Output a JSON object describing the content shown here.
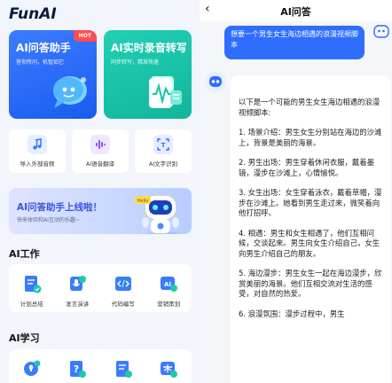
{
  "app": {
    "title": "FunAI"
  },
  "feature_cards": [
    {
      "title": "AI问答助手",
      "subtitle": "答你所问，机智如它",
      "badge": "HOT",
      "color": "#2a6bff"
    },
    {
      "title": "AI实时录音转写",
      "subtitle": "同步转写，精准快速",
      "color": "#17c3a6"
    }
  ],
  "tools": [
    {
      "label": "导入外部音频",
      "icon": "music-note-icon",
      "color": "#3a7bff"
    },
    {
      "label": "AI语音翻译",
      "icon": "soundwave-icon",
      "color": "#8a54f5"
    },
    {
      "label": "AI文字识别",
      "icon": "scan-text-icon",
      "color": "#2f6dff"
    }
  ],
  "banner": {
    "title": "AI问答助手上线啦！",
    "subtitle": "快来体验和AI互动的乐趣~",
    "robot_tag": "Hello"
  },
  "sections": [
    {
      "title": "AI工作",
      "items": [
        {
          "label": "计划总结",
          "icon": "document-check-icon"
        },
        {
          "label": "发言演讲",
          "icon": "microphone-icon"
        },
        {
          "label": "代码编写",
          "icon": "code-icon"
        },
        {
          "label": "营销策划",
          "icon": "ai-spark-icon"
        }
      ]
    },
    {
      "title": "AI学习",
      "items": [
        {
          "label": "",
          "icon": "lightbulb-icon"
        },
        {
          "label": "",
          "icon": "question-icon"
        },
        {
          "label": "",
          "icon": "edit-document-icon"
        },
        {
          "label": "",
          "icon": "translate-icon"
        }
      ]
    }
  ],
  "chat": {
    "back_icon": "chevron-left-icon",
    "title": "AI问答",
    "user_message": "想要一个男生女生海边相遇的浪漫视频脚本",
    "bot_intro": "以下是一个可能的男生女生海边相遇的浪漫视频脚本:",
    "bot_paragraphs": [
      "1. 场景介绍：男生女生分别站在海边的沙滩上，背景是美丽的海景。",
      "2. 男生出场：男生穿着休闲衣服，戴着墨镜，漫步在沙滩上，心情愉悦。",
      "3. 女生出场：女生穿着泳衣，戴着草帽，漫步在沙滩上。她看到男生走过来，微笑着向他打招呼。",
      "4. 相遇：男生和女生相遇了，他们互相问候，交谈起来。男生向女生介绍自己，女生向男生介绍自己的朋友。",
      "5. 海边漫步：男生女生一起在海边漫步，欣赏美丽的海景。他们互相交流对生活的感受，对自然的热爱。",
      "6. 浪漫氛围：漫步过程中，男生"
    ]
  }
}
